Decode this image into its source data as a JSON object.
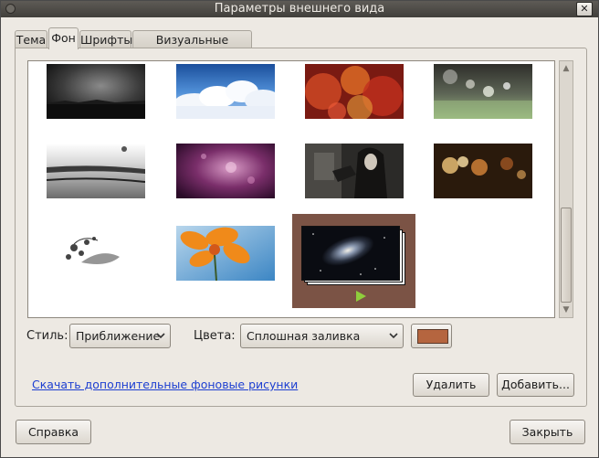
{
  "window": {
    "title": "Параметры внешнего вида",
    "close_glyph": "✕"
  },
  "tabs": [
    {
      "label": "Тема",
      "active": false
    },
    {
      "label": "Фон",
      "active": true
    },
    {
      "label": "Шрифты",
      "active": false
    },
    {
      "label": "Визуальные эффекты",
      "active": false
    }
  ],
  "wallpapers": [
    {
      "name": "dark-horizon",
      "selected": false
    },
    {
      "name": "blue-sky-clouds",
      "selected": false
    },
    {
      "name": "red-bokeh",
      "selected": false
    },
    {
      "name": "green-blurred-lights",
      "selected": false
    },
    {
      "name": "water-glass",
      "selected": false
    },
    {
      "name": "purple-bokeh",
      "selected": false
    },
    {
      "name": "girl-dark-photo",
      "selected": false
    },
    {
      "name": "warm-bokeh-lights",
      "selected": false
    },
    {
      "name": "flowers-sketch",
      "selected": false
    },
    {
      "name": "orange-flower",
      "selected": false
    },
    {
      "name": "spiral-galaxy-slideshow",
      "selected": true
    }
  ],
  "controls": {
    "style_label": "Стиль:",
    "style_value": "Приближение",
    "colors_label": "Цвета:",
    "colors_value": "Сплошная заливка",
    "color_swatch": "#b5653f",
    "download_link": "Скачать дополнительные фоновые рисунки",
    "remove_button": "Удалить",
    "add_button": "Добавить..."
  },
  "footer": {
    "help_button": "Справка",
    "close_button": "Закрыть"
  },
  "colors": {
    "selection_frame": "#7b5345",
    "titlebar": "#4b4844",
    "window_bg": "#ede9e3",
    "link": "#1d3fd1"
  }
}
